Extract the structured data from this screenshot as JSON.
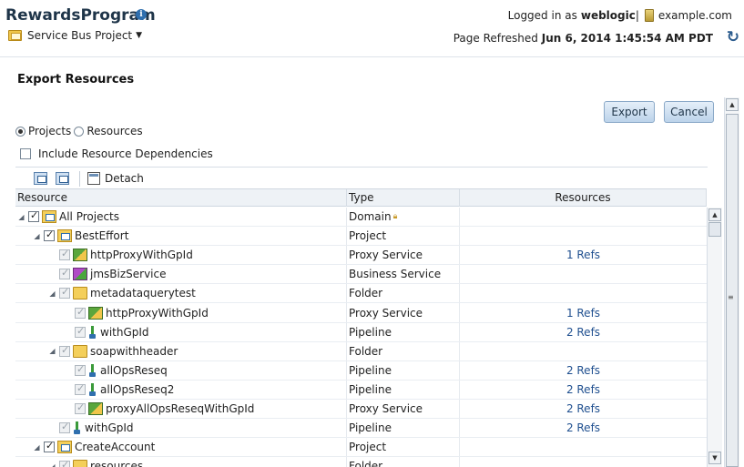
{
  "header": {
    "app_title": "RewardsProgram",
    "info_icon": "info-icon",
    "project_menu_label": "Service Bus Project",
    "logged_in_prefix": "Logged in as",
    "user": "weblogic",
    "separator": "|",
    "domain": "example.com",
    "page_refreshed_prefix": "Page Refreshed",
    "page_refreshed_value": "Jun 6, 2014 1:45:54 AM PDT"
  },
  "section": {
    "title": "Export Resources"
  },
  "buttons": {
    "export": "Export",
    "cancel": "Cancel"
  },
  "options": {
    "radio_projects": "Projects",
    "radio_resources": "Resources",
    "selected": "Projects",
    "include_deps": "Include Resource Dependencies"
  },
  "toolbar": {
    "detach": "Detach",
    "icons": [
      "expand-all-icon",
      "collapse-all-icon",
      "detach-icon"
    ]
  },
  "grid": {
    "columns": [
      "Resource",
      "Type",
      "Resources"
    ],
    "rows": [
      {
        "name": "All Projects",
        "type": "Domain",
        "refs": "",
        "level": 0,
        "expand": "open",
        "check": "on",
        "icon": "project",
        "locked": true
      },
      {
        "name": "BestEffort",
        "type": "Project",
        "refs": "",
        "level": 1,
        "expand": "open",
        "check": "on",
        "icon": "project"
      },
      {
        "name": "httpProxyWithGpId",
        "type": "Proxy Service",
        "refs": "1 Refs",
        "level": 2,
        "expand": "",
        "check": "dim",
        "icon": "proxy"
      },
      {
        "name": "jmsBizService",
        "type": "Business Service",
        "refs": "",
        "level": 2,
        "expand": "",
        "check": "dim",
        "icon": "business"
      },
      {
        "name": "metadataquerytest",
        "type": "Folder",
        "refs": "",
        "level": 2,
        "expand": "open",
        "check": "dim",
        "icon": "folder"
      },
      {
        "name": "httpProxyWithGpId",
        "type": "Proxy Service",
        "refs": "1 Refs",
        "level": 3,
        "expand": "",
        "check": "dim",
        "icon": "proxy"
      },
      {
        "name": "withGpId",
        "type": "Pipeline",
        "refs": "2 Refs",
        "level": 3,
        "expand": "",
        "check": "dim",
        "icon": "pipeline"
      },
      {
        "name": "soapwithheader",
        "type": "Folder",
        "refs": "",
        "level": 2,
        "expand": "open",
        "check": "dim",
        "icon": "folder"
      },
      {
        "name": "allOpsReseq",
        "type": "Pipeline",
        "refs": "2 Refs",
        "level": 3,
        "expand": "",
        "check": "dim",
        "icon": "pipeline"
      },
      {
        "name": "allOpsReseq2",
        "type": "Pipeline",
        "refs": "2 Refs",
        "level": 3,
        "expand": "",
        "check": "dim",
        "icon": "pipeline"
      },
      {
        "name": "proxyAllOpsReseqWithGpId",
        "type": "Proxy Service",
        "refs": "2 Refs",
        "level": 3,
        "expand": "",
        "check": "dim",
        "icon": "proxy"
      },
      {
        "name": "withGpId",
        "type": "Pipeline",
        "refs": "2 Refs",
        "level": 2,
        "expand": "",
        "check": "dim",
        "icon": "pipeline"
      },
      {
        "name": "CreateAccount",
        "type": "Project",
        "refs": "",
        "level": 1,
        "expand": "open",
        "check": "on",
        "icon": "project"
      },
      {
        "name": "resources",
        "type": "Folder",
        "refs": "",
        "level": 2,
        "expand": "open",
        "check": "dim",
        "icon": "folder"
      }
    ]
  },
  "colors": {
    "title": "#1f3549",
    "link": "#1f4f8f",
    "button_border": "#8ba9c8"
  }
}
